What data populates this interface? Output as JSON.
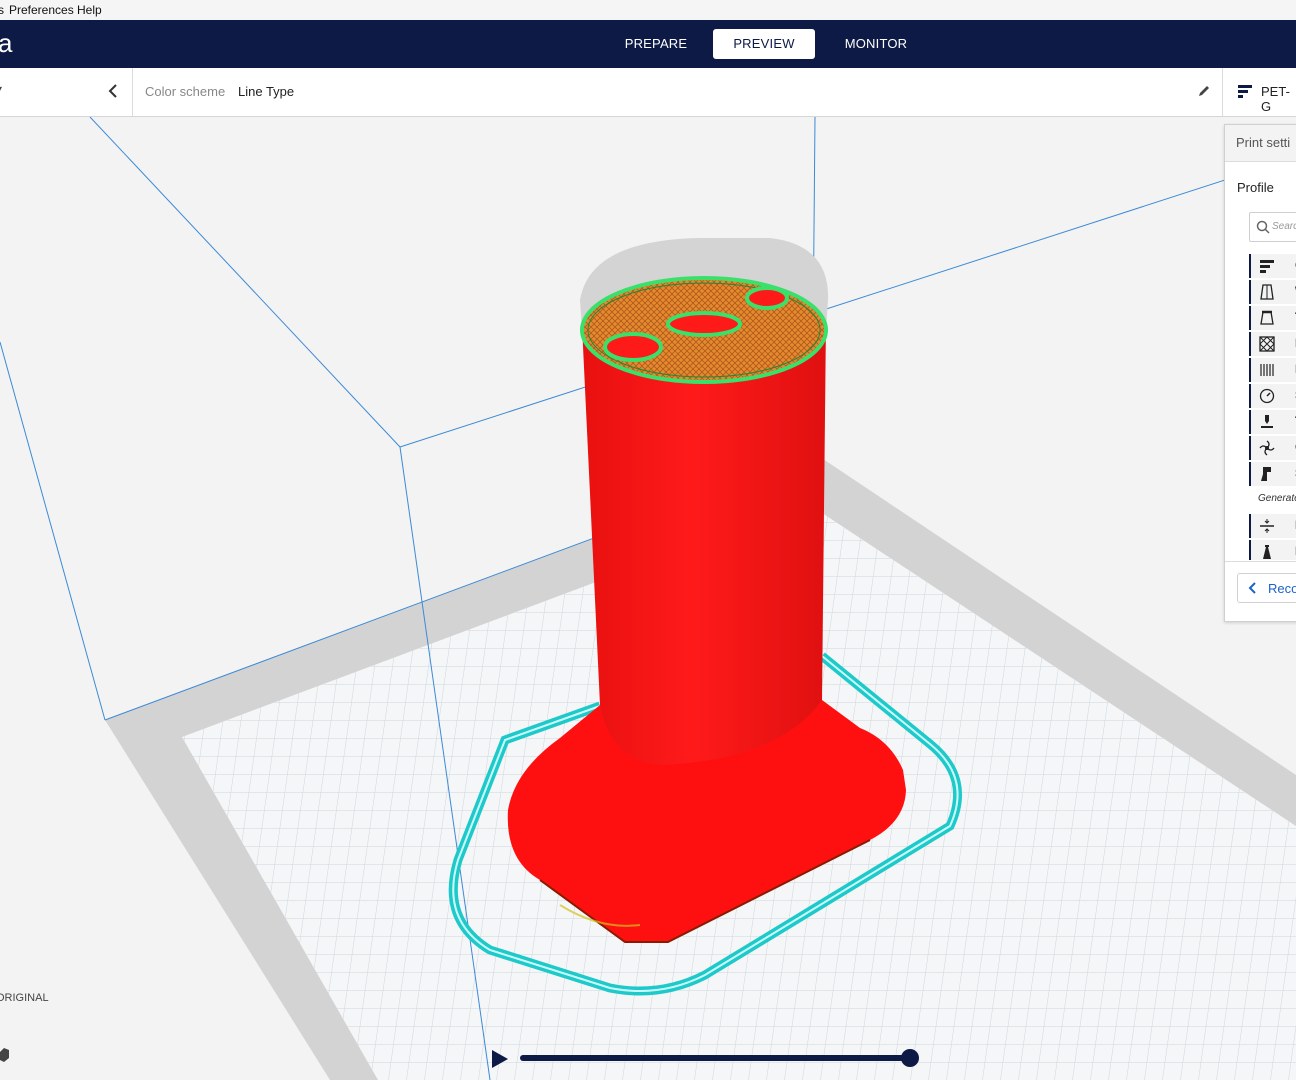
{
  "menubar": {
    "items": [
      {
        "label": "s"
      },
      {
        "label": "Preferences"
      },
      {
        "label": "Help"
      }
    ]
  },
  "header": {
    "brand": "a",
    "tabs": [
      {
        "label": "PREPARE"
      },
      {
        "label": "PREVIEW",
        "active": true
      },
      {
        "label": "MONITOR"
      }
    ]
  },
  "toolbar": {
    "view_dropdown_arrow": "▾",
    "color_scheme_label": "Color scheme",
    "color_scheme_value": "Line Type",
    "material": "PET-G"
  },
  "print_settings": {
    "title": "Print setti",
    "profile_label": "Profile",
    "search_placeholder": "Searc",
    "categories": [
      {
        "icon": "quality-icon",
        "letter": "Q"
      },
      {
        "icon": "walls-icon",
        "letter": "W"
      },
      {
        "icon": "top-bottom-icon",
        "letter": "T"
      },
      {
        "icon": "infill-icon",
        "letter": "I"
      },
      {
        "icon": "material-icon",
        "letter": "M"
      },
      {
        "icon": "speed-icon",
        "letter": "S"
      },
      {
        "icon": "travel-icon",
        "letter": "T"
      },
      {
        "icon": "cooling-icon",
        "letter": "C"
      },
      {
        "icon": "support-icon",
        "letter": "S"
      },
      {
        "icon": "build-plate-adhesion-icon",
        "letter": "B"
      },
      {
        "icon": "dual-extrusion-icon",
        "letter": "D"
      }
    ],
    "generate_label": "Generate",
    "recommended_button": "Reco"
  },
  "viewport": {
    "printer_name": "ORIGINAL",
    "model_color": "#ff1a1a",
    "skirt_color": "#2ee8e8",
    "shell_outline_color": "#39e06a",
    "top_infill_color": "#e58a2e",
    "layer_slider_progress": 1.0
  }
}
